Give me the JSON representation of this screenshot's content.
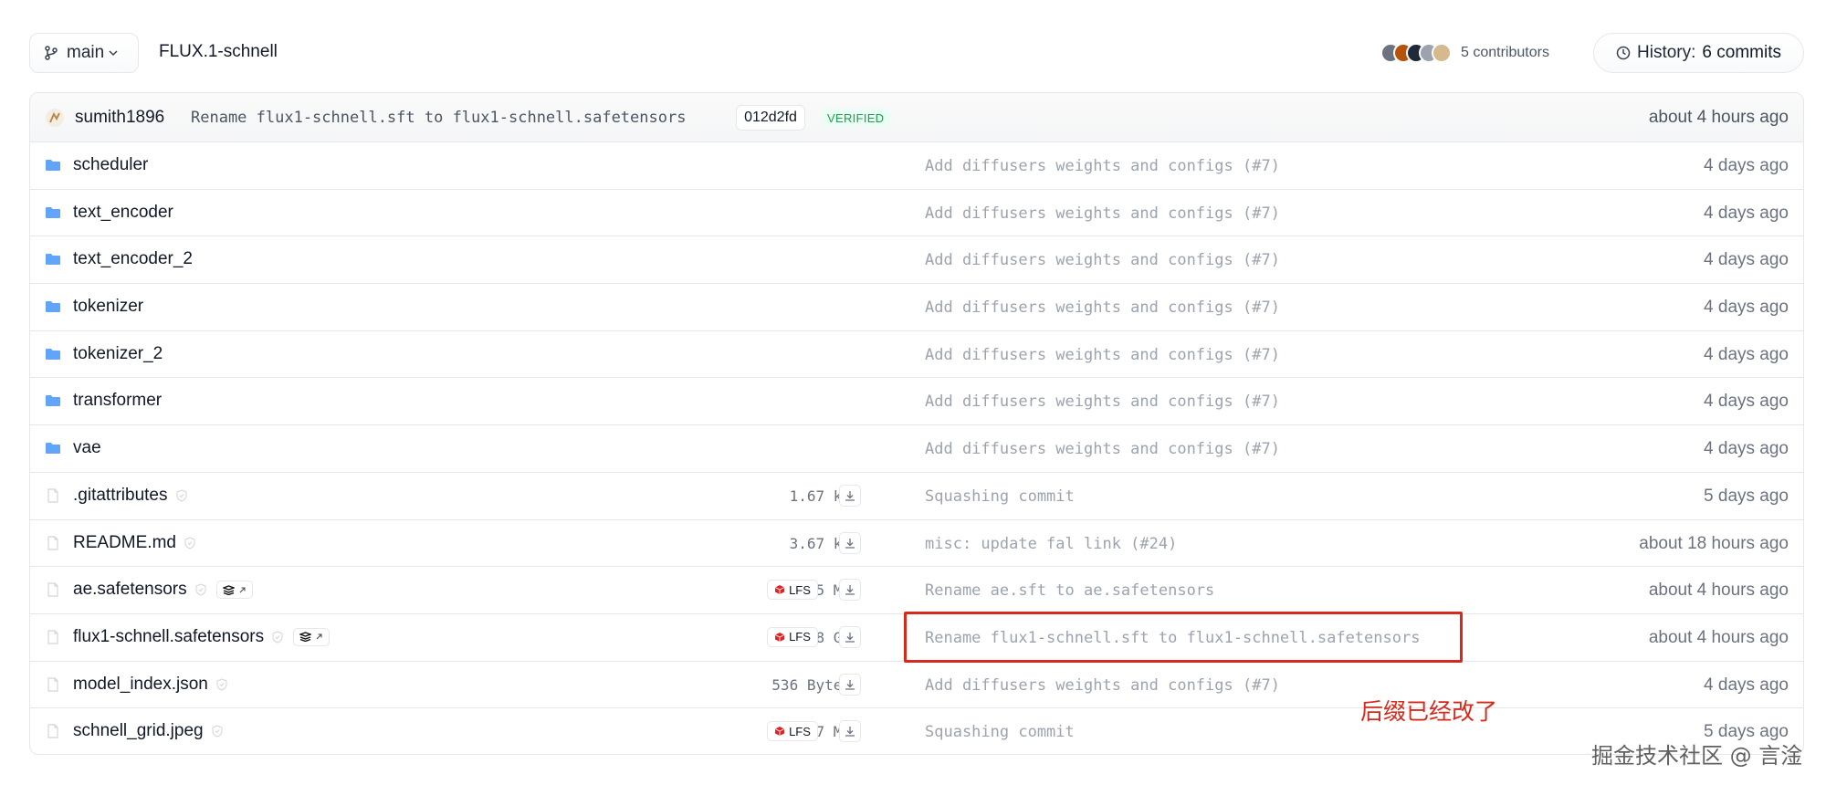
{
  "topbar": {
    "branch": "main",
    "repo_path": "FLUX.1-schnell",
    "contributors_label": "5 contributors",
    "history_label": "History:",
    "history_count": "6 commits"
  },
  "last_commit": {
    "author": "sumith1896",
    "message": "Rename flux1-schnell.sft to flux1-schnell.safetensors",
    "hash": "012d2fd",
    "verified": "VERIFIED",
    "time": "about 4 hours ago"
  },
  "files": [
    {
      "type": "folder",
      "name": "scheduler",
      "size": "",
      "lfs": false,
      "commit": "Add diffusers weights and configs (#7)",
      "time": "4 days ago"
    },
    {
      "type": "folder",
      "name": "text_encoder",
      "size": "",
      "lfs": false,
      "commit": "Add diffusers weights and configs (#7)",
      "time": "4 days ago"
    },
    {
      "type": "folder",
      "name": "text_encoder_2",
      "size": "",
      "lfs": false,
      "commit": "Add diffusers weights and configs (#7)",
      "time": "4 days ago"
    },
    {
      "type": "folder",
      "name": "tokenizer",
      "size": "",
      "lfs": false,
      "commit": "Add diffusers weights and configs (#7)",
      "time": "4 days ago"
    },
    {
      "type": "folder",
      "name": "tokenizer_2",
      "size": "",
      "lfs": false,
      "commit": "Add diffusers weights and configs (#7)",
      "time": "4 days ago"
    },
    {
      "type": "folder",
      "name": "transformer",
      "size": "",
      "lfs": false,
      "commit": "Add diffusers weights and configs (#7)",
      "time": "4 days ago"
    },
    {
      "type": "folder",
      "name": "vae",
      "size": "",
      "lfs": false,
      "commit": "Add diffusers weights and configs (#7)",
      "time": "4 days ago"
    },
    {
      "type": "file",
      "name": ".gitattributes",
      "size": "1.67 kB",
      "lfs": false,
      "xet": false,
      "commit": "Squashing commit",
      "time": "5 days ago"
    },
    {
      "type": "file",
      "name": "README.md",
      "size": "3.67 kB",
      "lfs": false,
      "xet": false,
      "commit": "misc: update fal link (#24)",
      "time": "about 18 hours ago"
    },
    {
      "type": "file",
      "name": "ae.safetensors",
      "size": "335 MB",
      "lfs": true,
      "xet": true,
      "commit": "Rename ae.sft to ae.safetensors",
      "time": "about 4 hours ago"
    },
    {
      "type": "file",
      "name": "flux1-schnell.safetensors",
      "size": "23.8 GB",
      "lfs": true,
      "xet": true,
      "commit": "Rename flux1-schnell.sft to flux1-schnell.safetensors",
      "time": "about 4 hours ago"
    },
    {
      "type": "file",
      "name": "model_index.json",
      "size": "536 Bytes",
      "lfs": false,
      "xet": false,
      "commit": "Add diffusers weights and configs (#7)",
      "time": "4 days ago"
    },
    {
      "type": "file",
      "name": "schnell_grid.jpeg",
      "size": "1.67 MB",
      "lfs": true,
      "xet": false,
      "commit": "Squashing commit",
      "time": "5 days ago"
    }
  ],
  "lfs_label": "LFS",
  "annotation": "后缀已经改了",
  "watermark": "掘金技术社区 @ 言淦",
  "colors": {
    "folder": "#60a5fa",
    "highlight": "#d42b1e",
    "verified": "#16a34a"
  }
}
